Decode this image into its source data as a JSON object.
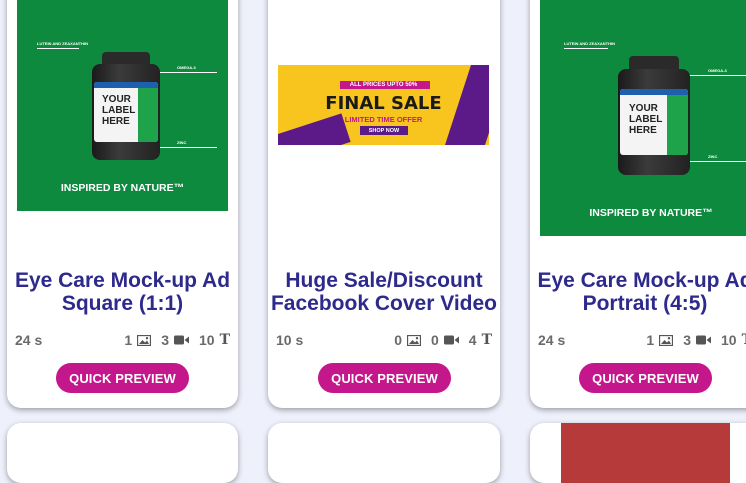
{
  "cards": [
    {
      "title_line1": "Eye Care Mock-up Ad",
      "title_line2": "Square (1:1)",
      "duration": "24 s",
      "images": "1",
      "videos": "3",
      "texts": "10",
      "button": "QUICK PREVIEW",
      "thumb": {
        "tag1": "LUTEIN AND ZEAXANTHIN",
        "tag2": "OMEGA-3",
        "tag3": "ZINC",
        "label": "YOUR LABEL HERE",
        "tagline": "INSPIRED BY NATURE™"
      }
    },
    {
      "title_line1": "Huge Sale/Discount",
      "title_line2": "Facebook Cover Video",
      "duration": "10 s",
      "images": "0",
      "videos": "0",
      "texts": "4",
      "button": "QUICK PREVIEW",
      "thumb": {
        "top": "ALL PRICES UPTO 50%",
        "headline": "FINAL SALE",
        "sub": "LIMITED TIME OFFER",
        "cta": "SHOP NOW"
      }
    },
    {
      "title_line1": "Eye Care Mock-up Ad",
      "title_line2": "Portrait (4:5)",
      "duration": "24 s",
      "images": "1",
      "videos": "3",
      "texts": "10",
      "button": "QUICK PREVIEW",
      "thumb": {
        "tag1": "LUTEIN AND ZEAXANTHIN",
        "tag2": "OMEGA-3",
        "tag3": "ZINC",
        "label": "YOUR LABEL HERE",
        "tagline": "INSPIRED BY NATURE™"
      }
    }
  ],
  "icons": {
    "image": "image-icon",
    "video": "video-camera-icon",
    "text": "text-icon"
  },
  "colors": {
    "title": "#2e2a8c",
    "button": "#c4178b",
    "thumb_green": "#0e8a3f",
    "sale_yellow": "#f7c51e",
    "sale_purple": "#5c1a88"
  }
}
